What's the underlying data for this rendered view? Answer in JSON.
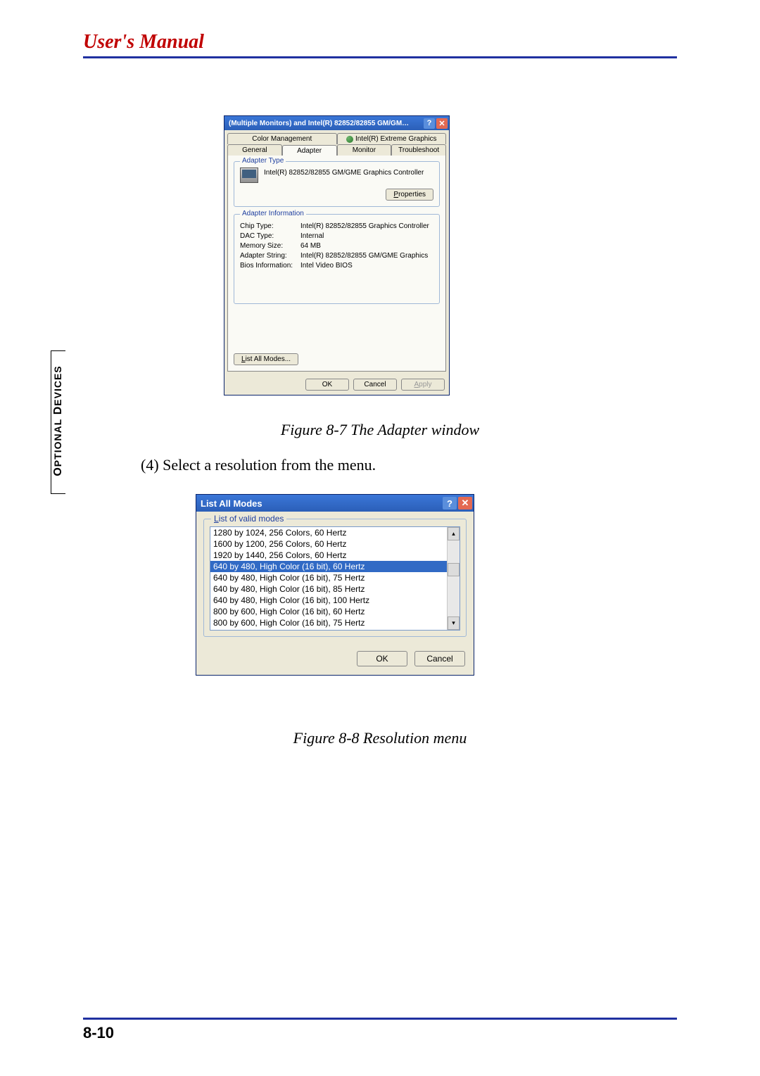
{
  "header": {
    "title": "User's Manual"
  },
  "sidebar": {
    "label_main": "O",
    "label_rest1": "PTIONAL",
    "label_main2": " D",
    "label_rest2": "EVICES"
  },
  "adapter_dialog": {
    "title": "(Multiple Monitors) and Intel(R) 82852/82855 GM/GM…",
    "tabs": {
      "row1": [
        {
          "label": "Color Management"
        },
        {
          "label": "Intel(R) Extreme Graphics",
          "icon": true
        }
      ],
      "row2": [
        {
          "label": "General"
        },
        {
          "label": "Adapter",
          "active": true
        },
        {
          "label": "Monitor"
        },
        {
          "label": "Troubleshoot"
        }
      ]
    },
    "adapter_type": {
      "legend": "Adapter Type",
      "value": "Intel(R) 82852/82855 GM/GME Graphics Controller",
      "properties_btn": "Properties"
    },
    "adapter_info": {
      "legend": "Adapter Information",
      "rows": [
        {
          "label": "Chip Type:",
          "value": "Intel(R) 82852/82855 Graphics Controller"
        },
        {
          "label": "DAC Type:",
          "value": "Internal"
        },
        {
          "label": "Memory Size:",
          "value": "64 MB"
        },
        {
          "label": "Adapter String:",
          "value": "Intel(R) 82852/82855 GM/GME Graphics"
        },
        {
          "label": "Bios Information:",
          "value": "Intel Video BIOS"
        }
      ]
    },
    "list_all_btn": "List All Modes...",
    "buttons": {
      "ok": "OK",
      "cancel": "Cancel",
      "apply": "Apply"
    }
  },
  "caption1": "Figure 8-7  The Adapter window",
  "body_step": "(4)  Select a resolution from the menu.",
  "modes_dialog": {
    "title": "List All Modes",
    "legend": "List of valid modes",
    "items": [
      "1280 by 1024, 256 Colors, 60 Hertz",
      "1600 by 1200, 256 Colors, 60 Hertz",
      "1920 by 1440, 256 Colors, 60 Hertz",
      "640 by 480, High Color (16 bit), 60 Hertz",
      "640 by 480, High Color (16 bit), 75 Hertz",
      "640 by 480, High Color (16 bit), 85 Hertz",
      "640 by 480, High Color (16 bit), 100 Hertz",
      "800 by 600, High Color (16 bit), 60 Hertz",
      "800 by 600, High Color (16 bit), 75 Hertz"
    ],
    "selected_index": 3,
    "buttons": {
      "ok": "OK",
      "cancel": "Cancel"
    }
  },
  "caption2": "Figure 8-8  Resolution menu",
  "footer": {
    "page": "8-10"
  }
}
